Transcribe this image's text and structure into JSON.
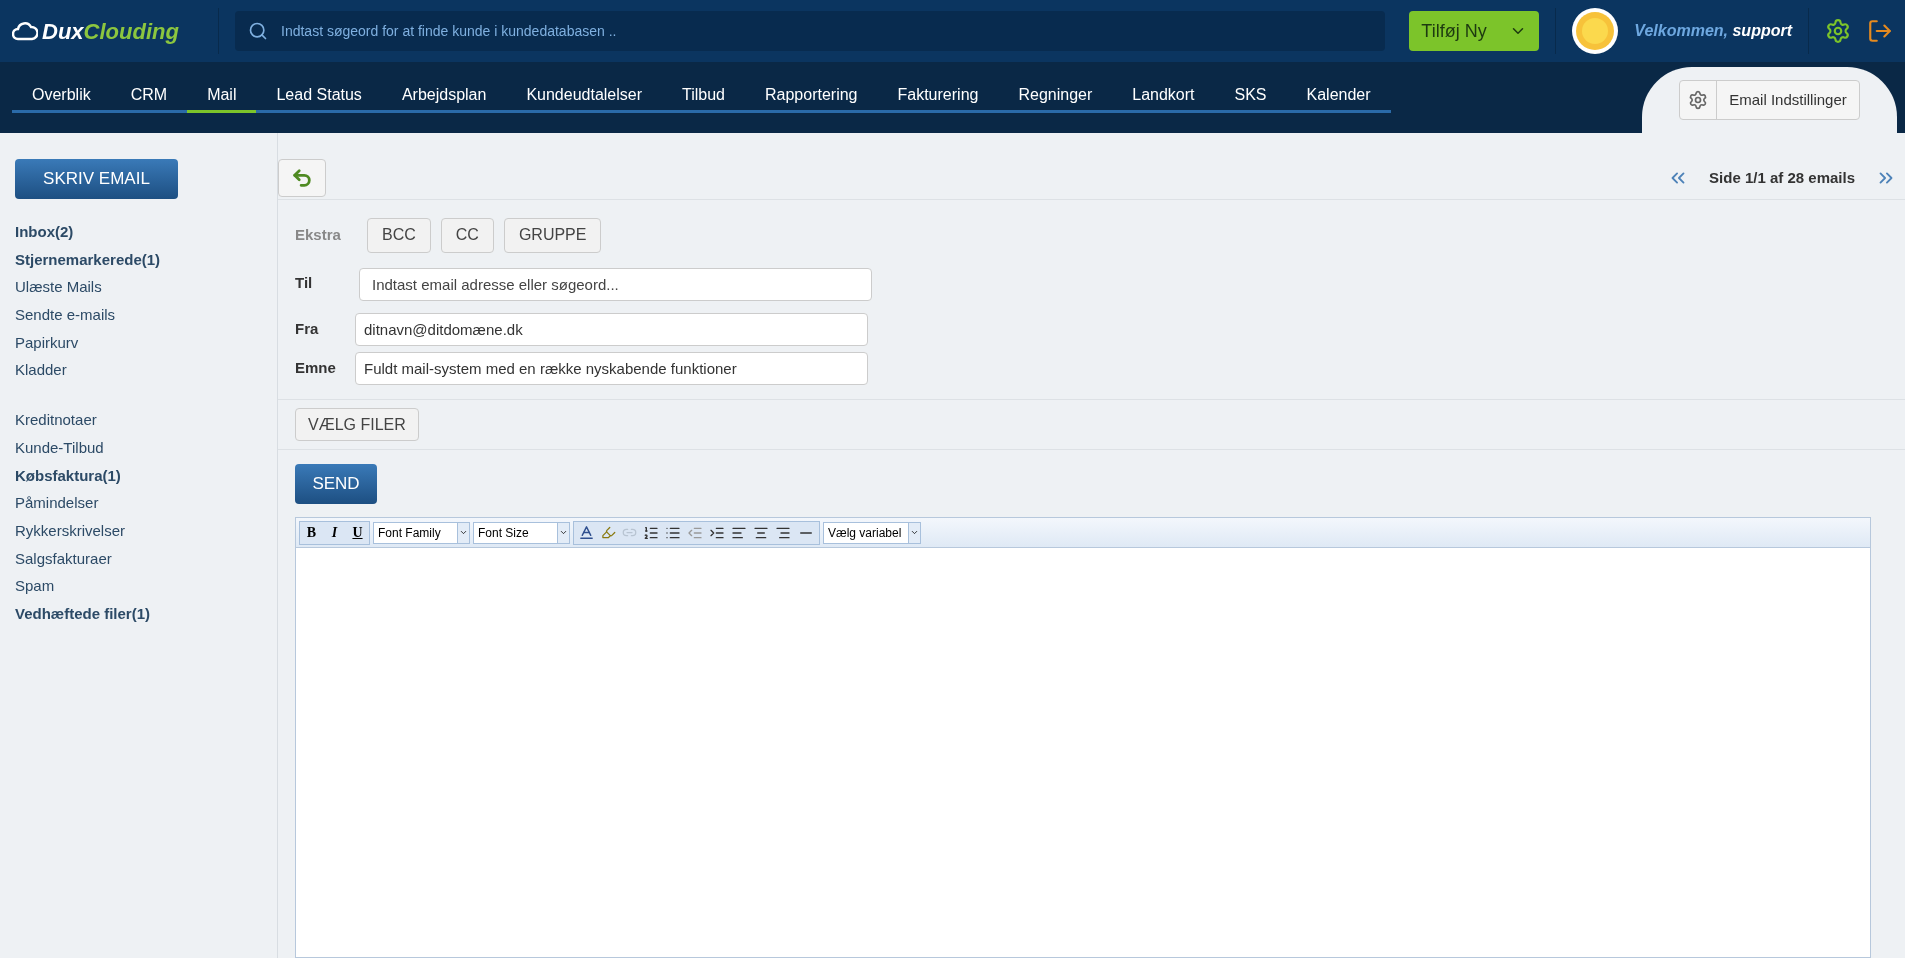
{
  "header": {
    "logo": {
      "first": "Dux",
      "second": "Clouding"
    },
    "search": {
      "placeholder": "Indtast søgeord for at finde kunde i kundedatabasen .."
    },
    "add_button": "Tilføj Ny",
    "welcome": {
      "greeting": "Velkommen,",
      "user": "support"
    }
  },
  "nav": {
    "tabs": [
      {
        "label": "Overblik",
        "selected": false
      },
      {
        "label": "CRM",
        "selected": false
      },
      {
        "label": "Mail",
        "selected": true
      },
      {
        "label": "Lead Status",
        "selected": false
      },
      {
        "label": "Arbejdsplan",
        "selected": false
      },
      {
        "label": "Kundeudtalelser",
        "selected": false
      },
      {
        "label": "Tilbud",
        "selected": false
      },
      {
        "label": "Rapportering",
        "selected": false
      },
      {
        "label": "Fakturering",
        "selected": false
      },
      {
        "label": "Regninger",
        "selected": false
      },
      {
        "label": "Landkort",
        "selected": false
      },
      {
        "label": "SKS",
        "selected": false
      },
      {
        "label": "Kalender",
        "selected": false
      }
    ],
    "settings_button": "Email Indstillinger"
  },
  "sidebar": {
    "compose_button": "SKRIV EMAIL",
    "groups": [
      [
        {
          "label": "Inbox(2)",
          "bold": true
        },
        {
          "label": "Stjernemarkerede(1)",
          "bold": true
        },
        {
          "label": "Ulæste Mails",
          "bold": false
        },
        {
          "label": "Sendte e-mails",
          "bold": false
        },
        {
          "label": "Papirkurv",
          "bold": false
        },
        {
          "label": "Kladder",
          "bold": false
        }
      ],
      [
        {
          "label": "Kreditnotaer",
          "bold": false
        },
        {
          "label": "Kunde-Tilbud",
          "bold": false
        },
        {
          "label": "Købsfaktura(1)",
          "bold": true
        },
        {
          "label": "Påmindelser",
          "bold": false
        },
        {
          "label": "Rykkerskrivelser",
          "bold": false
        },
        {
          "label": "Salgsfakturaer",
          "bold": false
        },
        {
          "label": "Spam",
          "bold": false
        },
        {
          "label": "Vedhæftede filer(1)",
          "bold": true
        }
      ]
    ]
  },
  "pager": "Side 1/1 af 28 emails",
  "compose": {
    "extra_label": "Ekstra",
    "extra_buttons": [
      "BCC",
      "CC",
      "GRUPPE"
    ],
    "fields": [
      {
        "label": "Til",
        "placeholder": "Indtast email adresse eller søgeord..."
      },
      {
        "label": "Fra",
        "value": "ditnavn@ditdomæne.dk"
      },
      {
        "label": "Emne",
        "value": "Fuldt mail-system med en række nyskabende funktioner"
      }
    ],
    "files_button": "VÆLG FILER",
    "send_button": "SEND"
  },
  "editor": {
    "format_buttons": [
      "B",
      "I",
      "U"
    ],
    "font_family": "Font Family",
    "font_size": "Font Size",
    "variable_select": "Vælg variabel"
  }
}
